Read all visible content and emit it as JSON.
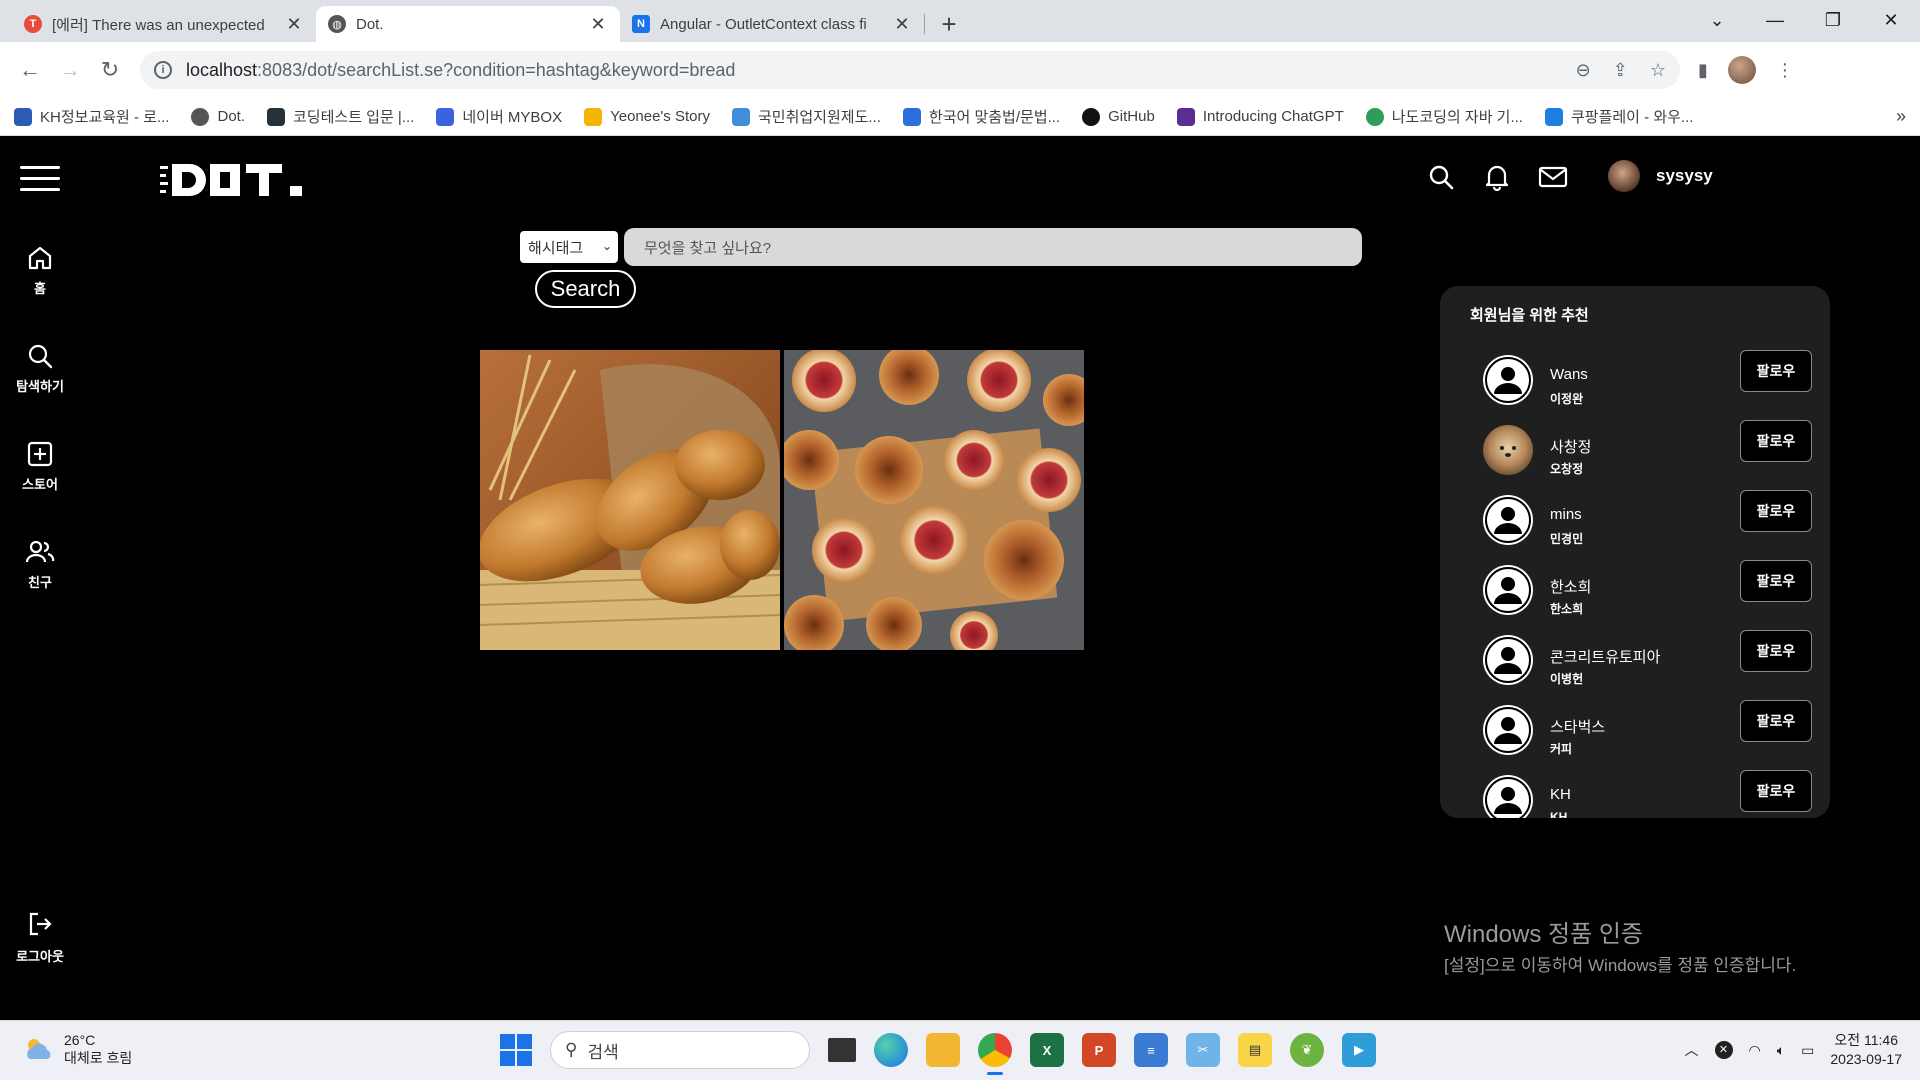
{
  "browser": {
    "tabs": [
      {
        "title": "[에러] There was an unexpected",
        "favicon_color": "#e74c3c",
        "active": false
      },
      {
        "title": "Dot.",
        "favicon_color": "#555555",
        "active": true
      },
      {
        "title": "Angular - OutletContext class fi",
        "favicon_color": "#1a73e8",
        "active": false
      }
    ],
    "url_host": "localhost",
    "url_rest": ":8083/dot/searchList.se?condition=hashtag&keyword=bread",
    "bookmarks": [
      {
        "label": "KH정보교육원 - 로...",
        "color": "#2b5bb5"
      },
      {
        "label": "Dot.",
        "color": "#555555"
      },
      {
        "label": "코딩테스트 입문 |...",
        "color": "#263238"
      },
      {
        "label": "네이버 MYBOX",
        "color": "#3b63e0"
      },
      {
        "label": "Yeonee's Story",
        "color": "#f4b400"
      },
      {
        "label": "국민취업지원제도...",
        "color": "#3f8fd8"
      },
      {
        "label": "한국어 맞춤법/문법...",
        "color": "#2b6fdc"
      },
      {
        "label": "GitHub",
        "color": "#111111"
      },
      {
        "label": "Introducing ChatGPT",
        "color": "#5c2d91"
      },
      {
        "label": "나도코딩의 자바 기...",
        "color": "#2e9d57"
      },
      {
        "label": "쿠팡플레이 - 와우...",
        "color": "#1d7fe0"
      }
    ]
  },
  "app": {
    "logo": "DOT.",
    "username": "sysysy",
    "sidebar": [
      {
        "label": "홈",
        "icon": "home-icon"
      },
      {
        "label": "탐색하기",
        "icon": "search-icon"
      },
      {
        "label": "스토어",
        "icon": "plus-square-icon"
      },
      {
        "label": "친구",
        "icon": "friends-icon"
      }
    ],
    "logout_label": "로그아웃",
    "search": {
      "condition": "해시태그",
      "placeholder": "무엇을 찾고 싶나요?",
      "button": "Search"
    },
    "recommend": {
      "title": "회원님을 위한 추천",
      "follow_label": "팔로우",
      "users": [
        {
          "nick": "Wans",
          "name": "이정완",
          "photo": false
        },
        {
          "nick": "사창정",
          "name": "오창정",
          "photo": true
        },
        {
          "nick": "mins",
          "name": "민경민",
          "photo": false
        },
        {
          "nick": "한소희",
          "name": "한소희",
          "photo": false
        },
        {
          "nick": "콘크리트유토피아",
          "name": "이병헌",
          "photo": false
        },
        {
          "nick": "스타벅스",
          "name": "커피",
          "photo": false
        },
        {
          "nick": "KH",
          "name": "KH",
          "photo": false
        }
      ]
    }
  },
  "windows_notice": {
    "title": "Windows 정품 인증",
    "subtitle": "[설정]으로 이동하여 Windows를 정품 인증합니다."
  },
  "taskbar": {
    "temperature": "26°C",
    "weather": "대체로 흐림",
    "search_placeholder": "검색",
    "time": "오전 11:46",
    "date": "2023-09-17"
  }
}
